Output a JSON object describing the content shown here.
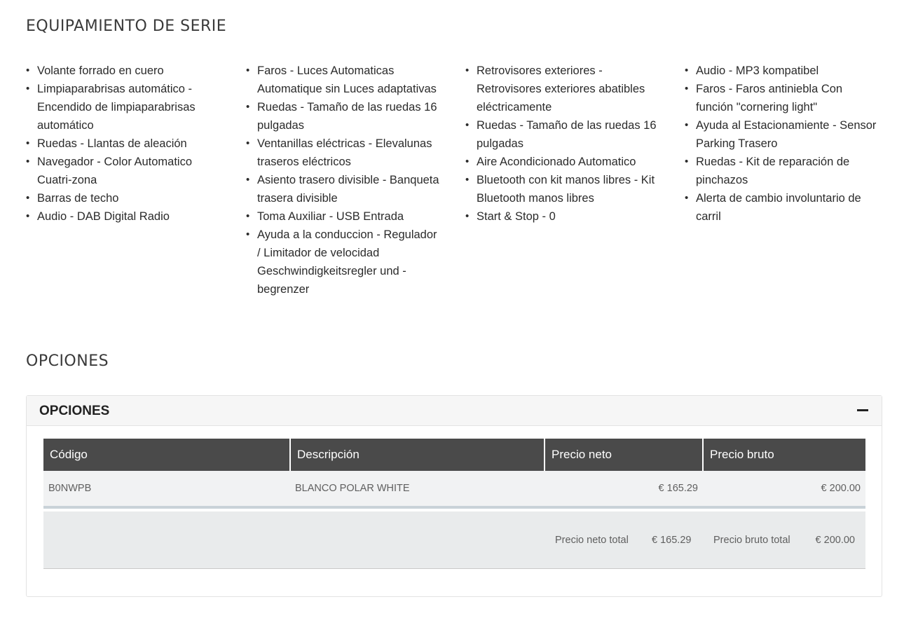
{
  "standard_equipment": {
    "title": "EQUIPAMIENTO DE SERIE",
    "columns": [
      [
        "Volante forrado en cuero",
        "Limpiaparabrisas automático - Encendido de limpiaparabrisas automático",
        "Ruedas - Llantas de aleación",
        "Navegador - Color Automatico Cuatri-zona",
        "Barras de techo",
        "Audio - DAB Digital Radio"
      ],
      [
        "Faros - Luces Automaticas Automatique sin Luces adaptativas",
        "Ruedas - Tamaño de las ruedas 16 pulgadas",
        "Ventanillas eléctricas - Elevalunas traseros eléctricos",
        "Asiento trasero divisible - Banqueta trasera divisible",
        "Toma Auxiliar - USB Entrada",
        "Ayuda a la conduccion - Regulador / Limitador de velocidad Geschwindigkeitsregler und -begrenzer"
      ],
      [
        "Retrovisores exteriores - Retrovisores exteriores abatibles eléctricamente",
        "Ruedas - Tamaño de las ruedas 16 pulgadas",
        "Aire Acondicionado Automatico",
        "Bluetooth con kit manos libres - Kit Bluetooth manos libres",
        "Start & Stop - 0"
      ],
      [
        "Audio - MP3 kompatibel",
        "Faros - Faros antiniebla Con función \"cornering light\"",
        "Ayuda al Estacionamiente - Sensor Parking Trasero",
        "Ruedas - Kit de reparación de pinchazos",
        "Alerta de cambio involuntario de carril"
      ]
    ]
  },
  "options": {
    "section_title": "OPCIONES",
    "panel_title": "OPCIONES",
    "collapse_icon": "minus-icon",
    "table": {
      "headers": [
        "Código",
        "Descripción",
        "Precio neto",
        "Precio bruto"
      ],
      "rows": [
        [
          "B0NWPB",
          "BLANCO POLAR WHITE",
          "€ 165.29",
          "€ 200.00"
        ]
      ]
    },
    "totals": {
      "neto_label": "Precio neto total",
      "neto_value": "€ 165.29",
      "bruto_label": "Precio bruto total",
      "bruto_value": "€ 200.00"
    }
  }
}
